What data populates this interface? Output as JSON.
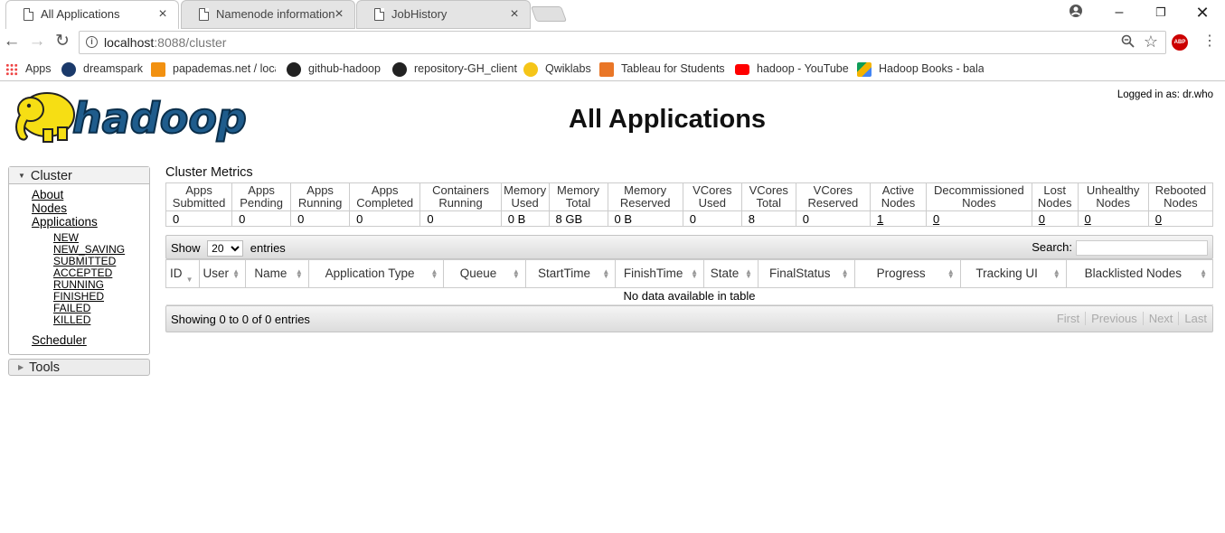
{
  "browser": {
    "tabs": [
      {
        "label": "All Applications",
        "active": true
      },
      {
        "label": "Namenode information",
        "active": false
      },
      {
        "label": "JobHistory",
        "active": false
      }
    ],
    "url_host": "localhost",
    "url_path": ":8088/cluster",
    "bookmarks": [
      {
        "label": "Apps",
        "icon": "apps-grid-icon",
        "color": "#4285f4"
      },
      {
        "label": "dreamspark",
        "icon": "dreamspark-icon",
        "color": "#1b3a6b"
      },
      {
        "label": "papademas.net / loca",
        "icon": "phpmyadmin-icon",
        "color": "#f29111"
      },
      {
        "label": "github-hadoop",
        "icon": "github-icon",
        "color": "#222222"
      },
      {
        "label": "repository-GH_client",
        "icon": "github-icon",
        "color": "#222222"
      },
      {
        "label": "Qwiklabs",
        "icon": "qwiklabs-icon",
        "color": "#f5c518"
      },
      {
        "label": "Tableau for Students",
        "icon": "tableau-icon",
        "color": "#e97627"
      },
      {
        "label": "hadoop - YouTube",
        "icon": "youtube-icon",
        "color": "#ff0000"
      },
      {
        "label": "Hadoop Books - bala",
        "icon": "google-drive-icon",
        "color": "#0f9d58"
      }
    ]
  },
  "header": {
    "logo_text": "hadoop",
    "logged_in": "Logged in as: dr.who",
    "title": "All Applications"
  },
  "sidebar": {
    "cluster_label": "Cluster",
    "links": [
      "About",
      "Nodes",
      "Applications"
    ],
    "states": [
      "NEW",
      "NEW_SAVING",
      "SUBMITTED",
      "ACCEPTED",
      "RUNNING",
      "FINISHED",
      "FAILED",
      "KILLED"
    ],
    "scheduler": "Scheduler",
    "tools_label": "Tools"
  },
  "metrics": {
    "title": "Cluster Metrics",
    "headers": [
      [
        "Apps",
        "Submitted"
      ],
      [
        "Apps",
        "Pending"
      ],
      [
        "Apps",
        "Running"
      ],
      [
        "Apps",
        "Completed"
      ],
      [
        "Containers",
        "Running"
      ],
      [
        "Memory",
        "Used"
      ],
      [
        "Memory",
        "Total"
      ],
      [
        "Memory",
        "Reserved"
      ],
      [
        "VCores",
        "Used"
      ],
      [
        "VCores",
        "Total"
      ],
      [
        "VCores",
        "Reserved"
      ],
      [
        "Active",
        "Nodes"
      ],
      [
        "Decommissioned",
        "Nodes"
      ],
      [
        "Lost",
        "Nodes"
      ],
      [
        "Unhealthy",
        "Nodes"
      ],
      [
        "Rebooted",
        "Nodes"
      ]
    ],
    "values": [
      "0",
      "0",
      "0",
      "0",
      "0",
      "0 B",
      "8 GB",
      "0 B",
      "0",
      "8",
      "0",
      "1",
      "0",
      "0",
      "0",
      "0"
    ],
    "linked": [
      false,
      false,
      false,
      false,
      false,
      false,
      false,
      false,
      false,
      false,
      false,
      true,
      true,
      true,
      true,
      true
    ]
  },
  "apps_table": {
    "show_label": "Show",
    "entries_value": "20",
    "entries_label": "entries",
    "search_label": "Search:",
    "columns": [
      "ID",
      "User",
      "Name",
      "Application Type",
      "Queue",
      "StartTime",
      "FinishTime",
      "State",
      "FinalStatus",
      "Progress",
      "Tracking UI",
      "Blacklisted Nodes"
    ],
    "empty_message": "No data available in table",
    "info": "Showing 0 to 0 of 0 entries",
    "pager": [
      "First",
      "Previous",
      "Next",
      "Last"
    ]
  }
}
